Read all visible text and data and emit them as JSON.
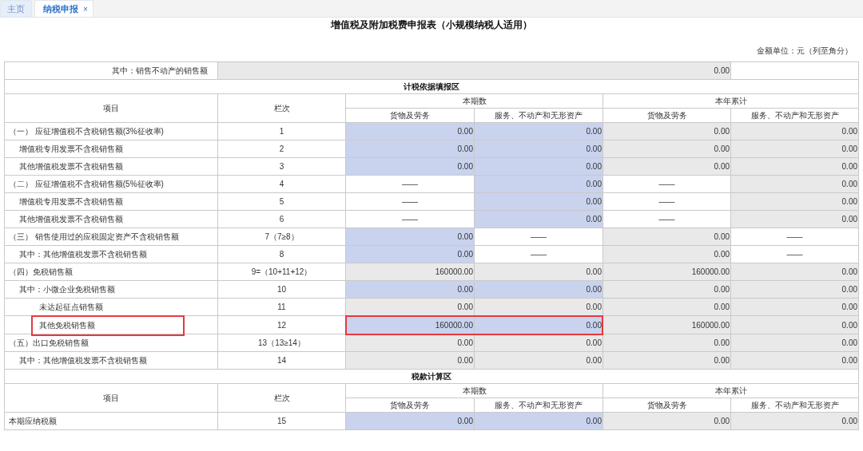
{
  "tabs": [
    {
      "label": "主页",
      "selected": false
    },
    {
      "label": "纳税申报",
      "selected": true,
      "close": "×"
    }
  ],
  "title": "增值税及附加税费申报表（小规模纳税人适用）",
  "unit_note": "金额单位：元（列至角分）",
  "top_row": {
    "label": "其中：销售不动产的销售额",
    "value": "0.00"
  },
  "sections": [
    {
      "title": "计税依据填报区",
      "columns": {
        "item": "项目",
        "line": "栏次",
        "groups": [
          {
            "label": "本期数",
            "subs": [
              "货物及劳务",
              "服务、不动产和无形资产"
            ]
          },
          {
            "label": "本年累计",
            "subs": [
              "货物及劳务",
              "服务、不动产和无形资产"
            ]
          }
        ]
      },
      "rows": [
        {
          "label": "（一） 应征增值税不含税销售额(3%征收率)",
          "line": "1",
          "highlighted": false,
          "cells": [
            {
              "value": "0.00",
              "kind": "input"
            },
            {
              "value": "0.00",
              "kind": "input"
            },
            {
              "value": "0.00",
              "kind": "readonly"
            },
            {
              "value": "0.00",
              "kind": "readonly"
            }
          ],
          "children": [
            {
              "label": "增值税专用发票不含税销售额",
              "line": "2",
              "highlighted": false,
              "cells": [
                {
                  "value": "0.00",
                  "kind": "input"
                },
                {
                  "value": "0.00",
                  "kind": "input"
                },
                {
                  "value": "0.00",
                  "kind": "readonly"
                },
                {
                  "value": "0.00",
                  "kind": "readonly"
                }
              ]
            },
            {
              "label": "其他增值税发票不含税销售额",
              "line": "3",
              "highlighted": false,
              "cells": [
                {
                  "value": "0.00",
                  "kind": "input"
                },
                {
                  "value": "0.00",
                  "kind": "input"
                },
                {
                  "value": "0.00",
                  "kind": "readonly"
                },
                {
                  "value": "0.00",
                  "kind": "readonly"
                }
              ]
            }
          ]
        },
        {
          "label": "（二） 应征增值税不含税销售额(5%征收率)",
          "line": "4",
          "highlighted": false,
          "cells": [
            {
              "value": "——",
              "kind": "blank"
            },
            {
              "value": "0.00",
              "kind": "input"
            },
            {
              "value": "——",
              "kind": "blank"
            },
            {
              "value": "0.00",
              "kind": "readonly"
            }
          ],
          "children": [
            {
              "label": "增值税专用发票不含税销售额",
              "line": "5",
              "highlighted": false,
              "cells": [
                {
                  "value": "——",
                  "kind": "blank"
                },
                {
                  "value": "0.00",
                  "kind": "input"
                },
                {
                  "value": "——",
                  "kind": "blank"
                },
                {
                  "value": "0.00",
                  "kind": "readonly"
                }
              ]
            },
            {
              "label": "其他增值税发票不含税销售额",
              "line": "6",
              "highlighted": false,
              "cells": [
                {
                  "value": "——",
                  "kind": "blank"
                },
                {
                  "value": "0.00",
                  "kind": "input"
                },
                {
                  "value": "——",
                  "kind": "blank"
                },
                {
                  "value": "0.00",
                  "kind": "readonly"
                }
              ]
            }
          ]
        },
        {
          "label": "（三） 销售使用过的应税固定资产不含税销售额",
          "line": "7（7≥8）",
          "highlighted": false,
          "cells": [
            {
              "value": "0.00",
              "kind": "input"
            },
            {
              "value": "——",
              "kind": "blank"
            },
            {
              "value": "0.00",
              "kind": "readonly"
            },
            {
              "value": "——",
              "kind": "blank"
            }
          ],
          "children": [
            {
              "label": "其中：其他增值税发票不含税销售额",
              "line": "8",
              "highlighted": false,
              "cells": [
                {
                  "value": "0.00",
                  "kind": "input"
                },
                {
                  "value": "——",
                  "kind": "blank"
                },
                {
                  "value": "0.00",
                  "kind": "readonly"
                },
                {
                  "value": "——",
                  "kind": "blank"
                }
              ]
            }
          ]
        },
        {
          "label": "（四）免税销售额",
          "line": "9=（10+11+12）",
          "highlighted": false,
          "cells": [
            {
              "value": "160000.00",
              "kind": "readonly"
            },
            {
              "value": "0.00",
              "kind": "readonly"
            },
            {
              "value": "160000.00",
              "kind": "readonly"
            },
            {
              "value": "0.00",
              "kind": "readonly"
            }
          ],
          "children": [
            {
              "label": "其中：小微企业免税销售额",
              "line": "10",
              "highlighted": false,
              "cells": [
                {
                  "value": "0.00",
                  "kind": "input"
                },
                {
                  "value": "0.00",
                  "kind": "input"
                },
                {
                  "value": "0.00",
                  "kind": "readonly"
                },
                {
                  "value": "0.00",
                  "kind": "readonly"
                }
              ],
              "children": [
                {
                  "label": "未达起征点销售额",
                  "line": "11",
                  "highlighted": false,
                  "cells": [
                    {
                      "value": "0.00",
                      "kind": "readonly"
                    },
                    {
                      "value": "0.00",
                      "kind": "readonly"
                    },
                    {
                      "value": "0.00",
                      "kind": "readonly"
                    },
                    {
                      "value": "0.00",
                      "kind": "readonly"
                    }
                  ]
                },
                {
                  "label": "其他免税销售额",
                  "line": "12",
                  "highlighted": true,
                  "cells": [
                    {
                      "value": "160000.00",
                      "kind": "input"
                    },
                    {
                      "value": "0.00",
                      "kind": "input"
                    },
                    {
                      "value": "160000.00",
                      "kind": "readonly"
                    },
                    {
                      "value": "0.00",
                      "kind": "readonly"
                    }
                  ]
                }
              ]
            }
          ]
        },
        {
          "label": "（五）出口免税销售额",
          "line": "13（13≥14）",
          "highlighted": false,
          "cells": [
            {
              "value": "0.00",
              "kind": "readonly"
            },
            {
              "value": "0.00",
              "kind": "readonly"
            },
            {
              "value": "0.00",
              "kind": "readonly"
            },
            {
              "value": "0.00",
              "kind": "readonly"
            }
          ],
          "children": [
            {
              "label": "其中：其他增值税发票不含税销售额",
              "line": "14",
              "highlighted": false,
              "cells": [
                {
                  "value": "0.00",
                  "kind": "readonly"
                },
                {
                  "value": "0.00",
                  "kind": "readonly"
                },
                {
                  "value": "0.00",
                  "kind": "readonly"
                },
                {
                  "value": "0.00",
                  "kind": "readonly"
                }
              ]
            }
          ]
        }
      ]
    },
    {
      "title": "税款计算区",
      "columns": {
        "item": "项目",
        "line": "栏次",
        "groups": [
          {
            "label": "本期数",
            "subs": [
              "货物及劳务",
              "服务、不动产和无形资产"
            ]
          },
          {
            "label": "本年累计",
            "subs": [
              "货物及劳务",
              "服务、不动产和无形资产"
            ]
          }
        ]
      },
      "rows": [
        {
          "label": "本期应纳税额",
          "line": "15",
          "highlighted": false,
          "cells": [
            {
              "value": "0.00",
              "kind": "input"
            },
            {
              "value": "0.00",
              "kind": "input"
            },
            {
              "value": "0.00",
              "kind": "readonly"
            },
            {
              "value": "0.00",
              "kind": "readonly"
            }
          ]
        }
      ]
    }
  ]
}
